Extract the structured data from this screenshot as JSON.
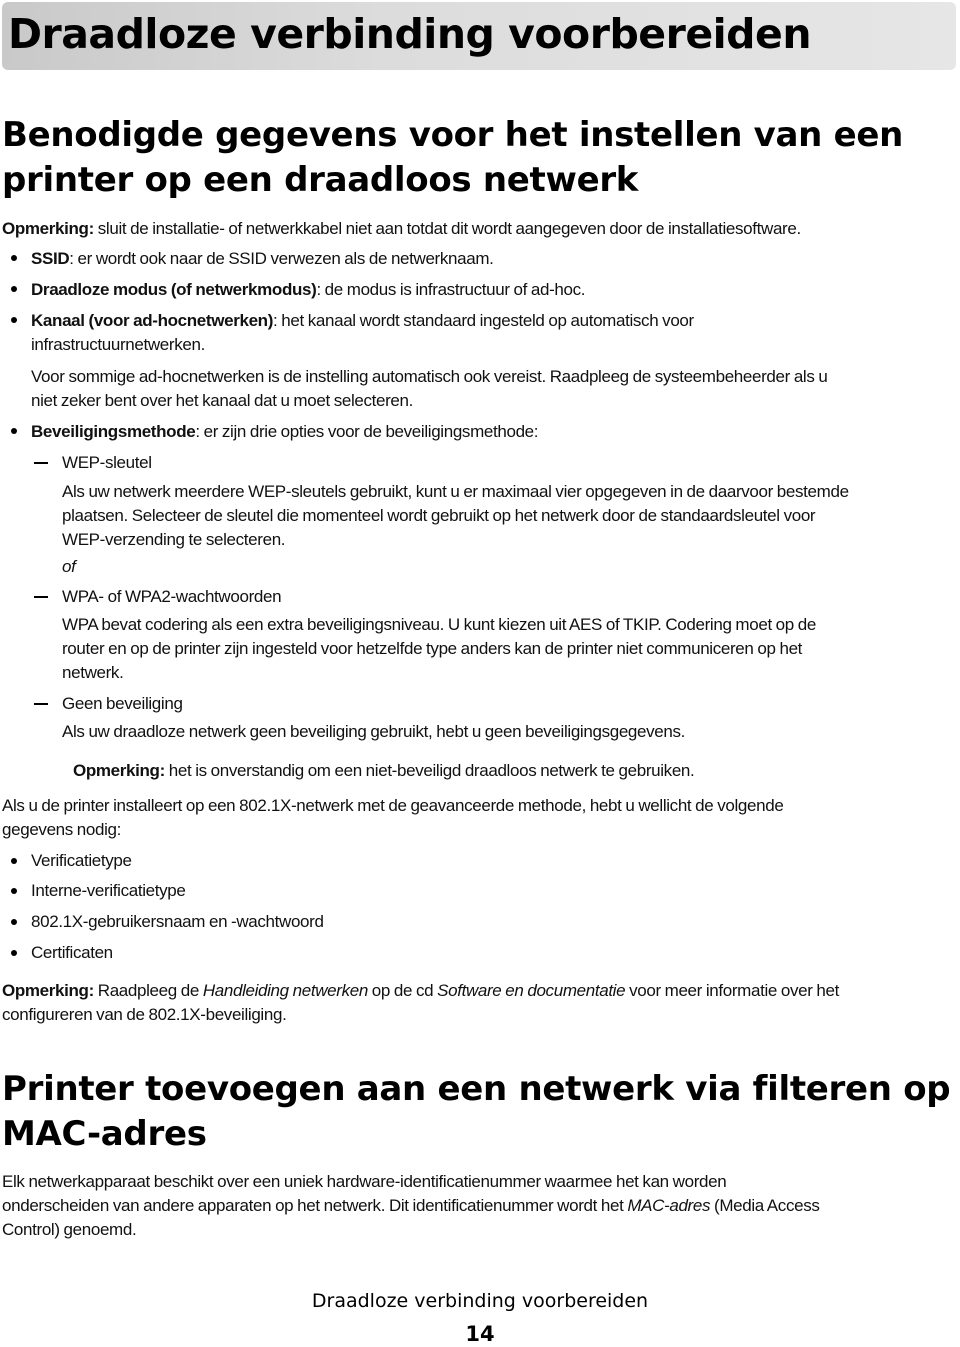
{
  "chapter": {
    "title": "Draadloze verbinding voorbereiden"
  },
  "section1": {
    "heading_line1": "Benodigde gegevens voor het instellen van een",
    "heading_line2": "printer op een draadloos netwerk",
    "note1": {
      "label": "Opmerking:",
      "text": " sluit de installatie- of netwerkkabel niet aan totdat dit wordt aangegeven door de installatiesoftware."
    },
    "bullets": [
      {
        "term": "SSID",
        "text": ": er wordt ook naar de SSID verwezen als de netwerknaam."
      },
      {
        "term": "Draadloze modus (of netwerkmodus)",
        "text": ": de modus is infrastructuur of ad-hoc."
      },
      {
        "term": "Kanaal (voor ad-hocnetwerken)",
        "text": ": het kanaal wordt standaard ingesteld op automatisch voor",
        "text_line2": "infrastructuurnetwerken.",
        "extra_line1": "Voor sommige ad-hocnetwerken is de instelling automatisch ook vereist. Raadpleeg de systeembeheerder als u",
        "extra_line2": "niet zeker bent over het kanaal dat u moet selecteren."
      },
      {
        "term": "Beveiligingsmethode",
        "text": ": er zijn drie opties voor de beveiligingsmethode:"
      }
    ],
    "security_options": [
      {
        "label": "WEP-sleutel",
        "lines": [
          "Als uw netwerk meerdere WEP-sleutels gebruikt, kunt u er maximaal vier opgegeven in de daarvoor bestemde",
          "plaatsen. Selecteer de sleutel die momenteel wordt gebruikt op het netwerk door de standaardsleutel voor",
          "WEP-verzending te selecteren."
        ]
      },
      {
        "label": "WPA- of WPA2-wachtwoorden",
        "lines": [
          "WPA bevat codering als een extra beveiligingsniveau. U kunt kiezen uit AES of TKIP. Codering moet op de",
          "router en op de printer zijn ingesteld voor hetzelfde type anders kan de printer niet communiceren op het",
          "netwerk."
        ]
      },
      {
        "label": "Geen beveiliging",
        "lines": [
          "Als uw draadloze netwerk geen beveiliging gebruikt, hebt u geen beveiligingsgegevens."
        ]
      }
    ],
    "or_text": "of",
    "note2": {
      "label": "Opmerking:",
      "text": " het is onverstandig om een niet-beveiligd draadloos netwerk te gebruiken."
    },
    "paragraph_8021x_line1": "Als u de printer installeert op een 802.1X-netwerk met de geavanceerde methode, hebt u wellicht de volgende",
    "paragraph_8021x_line2": "gegevens nodig:",
    "list_8021x": [
      "Verificatietype",
      "Interne-verificatietype",
      "802.1X-gebruikersnaam en -wachtwoord",
      "Certificaten"
    ],
    "note3": {
      "label": "Opmerking:",
      "part1": " Raadpleeg de ",
      "italic1": "Handleiding netwerken",
      "part2": " op de cd ",
      "italic2": "Software en documentatie",
      "part3": " voor meer informatie over het",
      "line2": "configureren van de 802.1X-beveiliging."
    }
  },
  "section2": {
    "heading_line1": "Printer toevoegen aan een netwerk via filteren op",
    "heading_line2": "MAC-adres",
    "para_line1": "Elk netwerkapparaat beschikt over een uniek hardware-identificatienummer waarmee het kan worden",
    "para_line2_part1": "onderscheiden van andere apparaten op het netwerk. Dit identificatienummer wordt het ",
    "para_line2_italic": "MAC-adres",
    "para_line2_part2": " (Media Access",
    "para_line3": "Control) genoemd."
  },
  "footer": {
    "title": "Draadloze verbinding voorbereiden",
    "page_number": "14"
  }
}
